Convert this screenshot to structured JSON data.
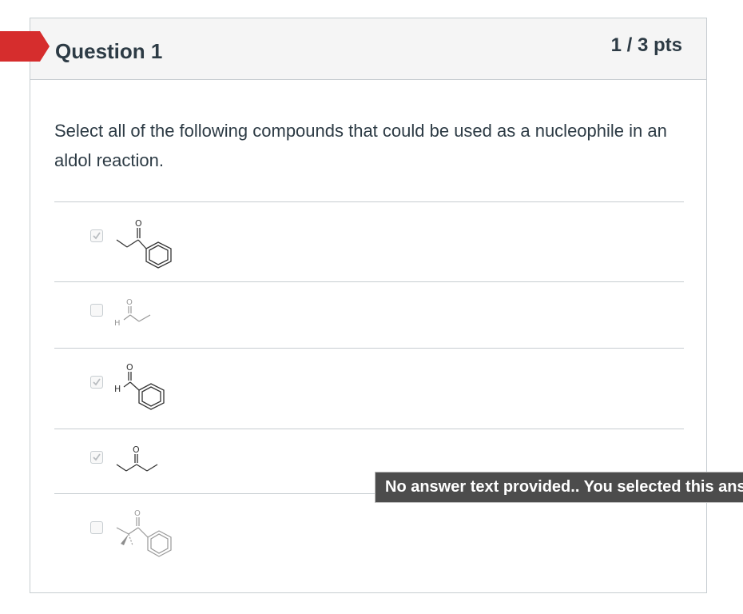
{
  "question": {
    "title": "Question 1",
    "points": "1 / 3 pts",
    "text": "Select all of the following compounds that could be used as a nucleophile in an aldol reaction.",
    "flag_color": "#d62d2d"
  },
  "answers": [
    {
      "compound": "1-phenylpropan-1-one",
      "selected": true,
      "atom_labels": [
        "O"
      ]
    },
    {
      "compound": "propanal",
      "selected": false,
      "atom_labels": [
        "O",
        "H"
      ]
    },
    {
      "compound": "benzaldehyde",
      "selected": true,
      "atom_labels": [
        "O",
        "H"
      ]
    },
    {
      "compound": "pentan-3-one",
      "selected": true,
      "atom_labels": [
        "O"
      ]
    },
    {
      "compound": "2,2-dimethyl-1-phenylpropan-1-one",
      "selected": false,
      "atom_labels": [
        "O"
      ]
    }
  ],
  "tooltip": {
    "text": "No answer text provided.. You selected this answer."
  }
}
